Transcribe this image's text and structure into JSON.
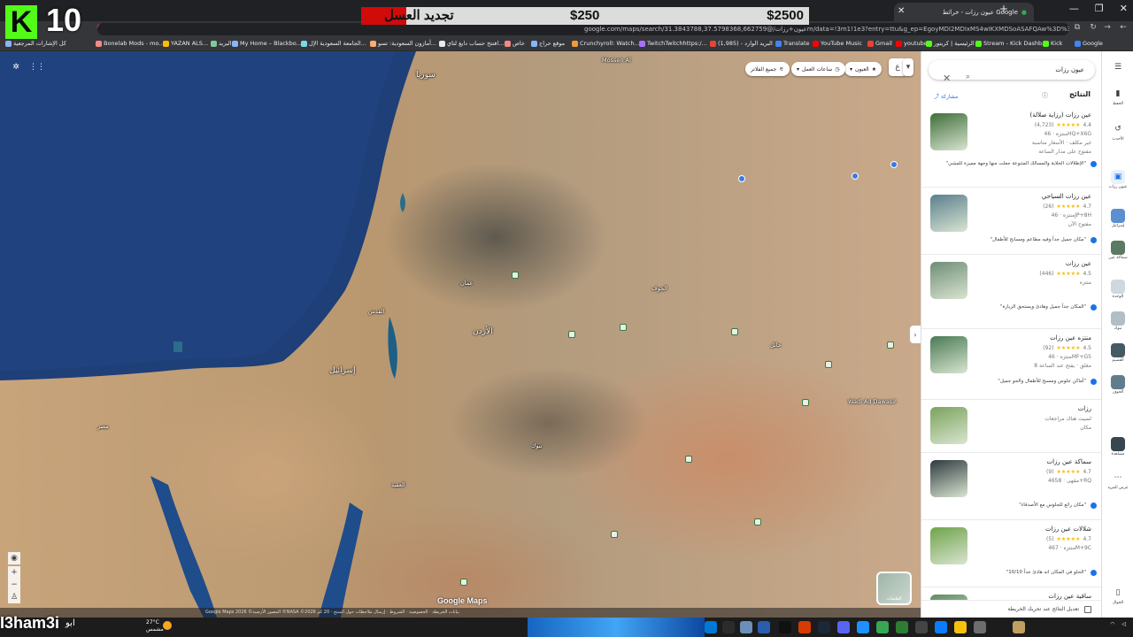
{
  "overlay": {
    "k_logo": "K",
    "count": "10",
    "goal_title": "تجديد العسل",
    "goal_current": "$250",
    "goal_target": "$2500",
    "goal_progress": 0.1,
    "handle": "I3ham3i",
    "handle_sub": "ابو"
  },
  "browser": {
    "tab_title": "عيون رزات - خرائط Google",
    "url": "google.com/maps/search/عيون+رزات/@31.3843788,37.5798368,662759m/data=!3m1!1e3?entry=ttu&g_ep=EgoyMDI2MDIxMS4wIKXMDSoASAFQAw%3D%3D",
    "bookmarks": [
      "كل الإشارات المرجعية",
      "Bonelab Mods - mo...",
      "YAZAN ALS...",
      "البريد",
      "My Home – Blackbo...",
      "الجامعة السعودية الإل...",
      "أمازون السعودية: تسو...",
      "افتتح حساب دايغ لتاي...",
      "خاص",
      "موقع حراج",
      "Crunchyroll: Watch...",
      "TwitchTwitchhttps:/...",
      "(1,985) - البريد الوارد",
      "Translate",
      "YouTube Music",
      "Gmail",
      "youtube",
      "الرئيسية | كريتور",
      "Stream - Kick Dashb...",
      "Kick",
      "Google"
    ]
  },
  "map": {
    "chips": {
      "time_label": "العيون",
      "hours_label": "ساعات العمل",
      "all_filters": "جميع الفلاتر"
    },
    "labels": [
      {
        "text": "سوريا",
        "size": "big"
      },
      {
        "text": "الأردن",
        "size": "big"
      },
      {
        "text": "إسرائيل",
        "size": "big"
      },
      {
        "text": "مصر",
        "size": "normal"
      },
      {
        "text": "عمان",
        "size": "normal"
      },
      {
        "text": "القدس",
        "size": "normal"
      },
      {
        "text": "العقبة",
        "size": "normal"
      },
      {
        "text": "تبوك",
        "size": "normal"
      },
      {
        "text": "حائل",
        "size": "normal"
      },
      {
        "text": "الجوف",
        "size": "normal"
      },
      {
        "text": "Wadi Ad Dawasir",
        "size": "normal"
      },
      {
        "text": "Mossen Al",
        "size": "normal"
      }
    ],
    "google_logo": "Google Maps",
    "footer": "Google Maps 2026 ©المصور الأرضية ©NASA ©2026 بيانات الخريطة · الخصوصية · الشروط · إرسال ملاحظات حول المنتج · 20 كم",
    "layers_label": "الطبقات"
  },
  "panel": {
    "search_value": "عيون رزات",
    "results_title": "النتائج",
    "share_label": "مشاركة",
    "results": [
      {
        "name": "عين رزات (رزاية صلالة)",
        "rating": "4.4",
        "reviews": "(4,723)",
        "lines": [
          "منتزه · 46HQ+X6G",
          "غير مكلف · الأسعار مناسبة",
          "مفتوح على مدار الساعة"
        ],
        "review": "\"الإطلالات الخلابة والمسالك المتنوعة جعلت منها وجهة مميزة للمشي\"",
        "thumb_color": "#3f6e3a"
      },
      {
        "name": "عين رزات السياحي",
        "rating": "4.7",
        "reviews": "(26)",
        "lines": [
          "منتزه · 46JP+8H",
          "مفتوح الآن"
        ],
        "review": "\"مكان جميل جداً وفيه مطاعم ومسابح للأطفال\"",
        "thumb_color": "#5a7f8e"
      },
      {
        "name": "عين رزات",
        "rating": "4.5",
        "reviews": "(446)",
        "lines": [
          "منتزه"
        ],
        "review": "\"المكان جداً جميل وهادئ ويستحق الزيارة\"",
        "thumb_color": "#6f8d76"
      },
      {
        "name": "منتزه عين رزات",
        "rating": "4.5",
        "reviews": "(92)",
        "lines": [
          "منتزه · 46MF+G5",
          "مغلق · يفتح عند الساعة 8"
        ],
        "review": "\"أماكن جلوس ومسبح للأطفال والجو جميل\"",
        "thumb_color": "#4a7a55"
      },
      {
        "name": "رزات",
        "rating": "",
        "reviews": "",
        "lines": [
          "لسيت هناك مراجعات",
          "مكان"
        ],
        "review": "",
        "thumb_color": "#7aa35c"
      },
      {
        "name": "سماكة عين رزات",
        "rating": "4.7",
        "reviews": "(9)",
        "lines": [
          "مقهى · 4658+RQ"
        ],
        "review": "\"مكان رائع للجلوس مع الأصدقاء\"",
        "thumb_color": "#2f3a40"
      },
      {
        "name": "شلالات عين رزات",
        "rating": "4.7",
        "reviews": "(5)",
        "lines": [
          "منتزه · 467M+9C"
        ],
        "review": "\"الحلو في المكان انه هادئ جداً 10/10\"",
        "thumb_color": "#6ea34a"
      },
      {
        "name": "ساقية عين رزات",
        "rating": "",
        "reviews": "",
        "lines": [],
        "review": "",
        "thumb_color": "#5f8c62"
      }
    ],
    "footer_label": "تعديل النتائج عند تحريك الخريطة"
  },
  "rail": {
    "items": [
      "الحفظ",
      "الأحدث",
      "عيون رزات",
      "إسرائيل",
      "سماكة عين",
      "الوحدة",
      "تبوك",
      "القصيم",
      "الجوف",
      "مشاهدة",
      "عرض المزيد",
      "الجوال"
    ]
  },
  "taskbar": {
    "temp": "27°C",
    "weather": "مشمس"
  }
}
